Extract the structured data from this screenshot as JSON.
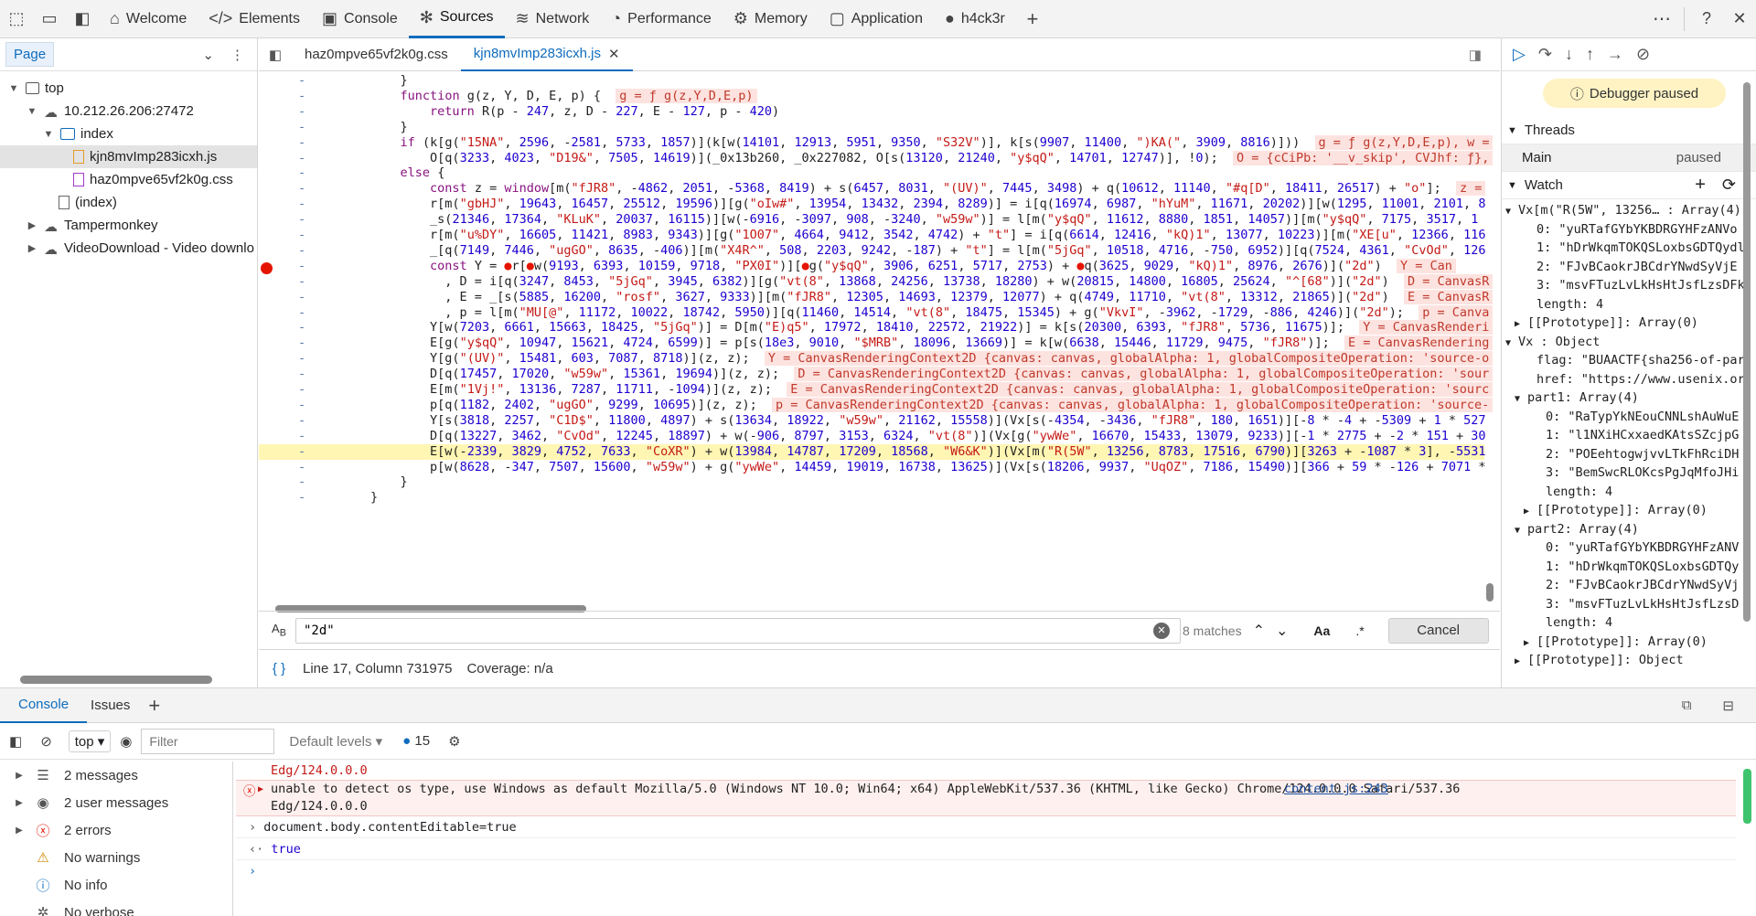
{
  "topbar": {
    "tabs": [
      {
        "label": "Welcome",
        "icon": "home-icon"
      },
      {
        "label": "Elements",
        "icon": "code-icon"
      },
      {
        "label": "Console",
        "icon": "console-icon"
      },
      {
        "label": "Sources",
        "icon": "bug-icon"
      },
      {
        "label": "Network",
        "icon": "wifi-icon"
      },
      {
        "label": "Performance",
        "icon": "gauge-icon"
      },
      {
        "label": "Memory",
        "icon": "chip-icon"
      },
      {
        "label": "Application",
        "icon": "app-icon"
      },
      {
        "label": "h4ck3r",
        "icon": "avatar-icon"
      }
    ],
    "active_tab": "Sources"
  },
  "navigator": {
    "header": "Page",
    "tree": [
      "top",
      "10.212.26.206:27472",
      "index",
      "kjn8mvImp283icxh.js",
      "haz0mpve65vf2k0g.css",
      "(index)",
      "Tampermonkey",
      "VideoDownload - Video downlo"
    ]
  },
  "editor": {
    "tabs": [
      "haz0mpve65vf2k0g.css",
      "kjn8mvImp283icxh.js"
    ],
    "active_tab": "kjn8mvImp283icxh.js"
  },
  "code_lines": [
    {
      "text": "            }",
      "hl": false,
      "bp": false
    },
    {
      "text": "            function g(z, Y, D, E, p) {  ",
      "inline": "g = ƒ g(z,Y,D,E,p)",
      "hl": false,
      "bp": false
    },
    {
      "text": "                return R(p - 247, z, D - 227, E - 127, p - 420)",
      "hl": false,
      "bp": false
    },
    {
      "text": "            }",
      "hl": false,
      "bp": false
    },
    {
      "text": "            if (k[g(\"15NA\", 2596, -2581, 5733, 1857)](k[w(14101, 12913, 5951, 9350, \"S32V\")], k[s(9907, 11400, \")KA(\", 3909, 8816)]))  ",
      "inline": "g = ƒ g(z,Y,D,E,p), w =",
      "hl": false,
      "bp": false
    },
    {
      "text": "                O[q(3233, 4023, \"D19&\", 7505, 14619)](_0x13b260, _0x227082, O[s(13120, 21240, \"y$qQ\", 14701, 12747)], !0);  ",
      "inline": "O = {cCiPb: '__v_skip', CVJhf: ƒ},",
      "hl": false,
      "bp": false
    },
    {
      "text": "            else {",
      "hl": false,
      "bp": false
    },
    {
      "text": "                const z = window[m(\"fJR8\", -4862, 2051, -5368, 8419) + s(6457, 8031, \"(UV)\", 7445, 3498) + q(10612, 11140, \"#q[D\", 18411, 26517) + \"o\"];  ",
      "inline": "z =",
      "hl": false,
      "bp": false
    },
    {
      "text": "                r[m(\"gbHJ\", 19643, 16457, 25512, 19596)][g(\"oIw#\", 13954, 13432, 2394, 8289)] = i[q(16974, 6987, \"hYuM\", 11671, 20202)][w(1295, 11001, 2101, 8",
      "hl": false,
      "bp": false
    },
    {
      "text": "                _s(21346, 17364, \"KLuK\", 20037, 16115)][w(-6916, -3097, 908, -3240, \"w59w\")] = l[m(\"y$qQ\", 11612, 8880, 1851, 14057)][m(\"y$qQ\", 7175, 3517, 1",
      "hl": false,
      "bp": false
    },
    {
      "text": "                r[m(\"u%DY\", 16605, 11421, 8983, 9343)][g(\"1O07\", 4664, 9412, 3542, 4742) + \"t\"] = i[q(6614, 12416, \"kQ)1\", 13077, 10223)][m(\"XE[u\", 12366, 116",
      "hl": false,
      "bp": false
    },
    {
      "text": "                _[q(7149, 7446, \"ugGO\", 8635, -406)][m(\"X4R^\", 508, 2203, 9242, -187) + \"t\"] = l[m(\"5jGq\", 10518, 4716, -750, 6952)][q(7524, 4361, \"CvOd\", 126",
      "hl": false,
      "bp": false
    },
    {
      "text": "                const Y = ●r[●w(9193, 6393, 10159, 9718, \"PX0I\")][●g(\"y$qQ\", 3906, 6251, 5717, 2753) + ●q(3625, 9029, \"kQ)1\", 8976, 2676)](\"2d\")  ",
      "inline": "Y = Can",
      "hl": false,
      "bp": true
    },
    {
      "text": "                  , D = i[q(3247, 8453, \"5jGq\", 3945, 6382)][g(\"vt(8\", 13868, 24256, 13738, 18280) + w(20815, 14800, 16805, 25624, \"^[68\")](\"2d\")  ",
      "inline": "D = CanvasR",
      "hl": false,
      "bp": false
    },
    {
      "text": "                  , E = _[s(5885, 16200, \"rosf\", 3627, 9333)][m(\"fJR8\", 12305, 14693, 12379, 12077) + q(4749, 11710, \"vt(8\", 13312, 21865)](\"2d\")  ",
      "inline": "E = CanvasR",
      "hl": false,
      "bp": false
    },
    {
      "text": "                  , p = l[m(\"MU[@\", 11172, 10022, 18742, 5950)][q(11460, 14514, \"vt(8\", 18475, 15345) + g(\"VkvI\", -3962, -1729, -886, 4246)](\"2d\");  ",
      "inline": "p = Canva",
      "hl": false,
      "bp": false
    },
    {
      "text": "                Y[w(7203, 6661, 15663, 18425, \"5jGq\")] = D[m(\"E)q5\", 17972, 18410, 22572, 21922)] = k[s(20300, 6393, \"fJR8\", 5736, 11675)];  ",
      "inline": "Y = CanvasRenderi",
      "hl": false,
      "bp": false
    },
    {
      "text": "                E[g(\"y$qQ\", 10947, 15621, 4724, 6599)] = p[s(18e3, 9010, \"$MRB\", 18096, 13669)] = k[w(6638, 15446, 11729, 9475, \"fJR8\")];  ",
      "inline": "E = CanvasRendering",
      "hl": false,
      "bp": false
    },
    {
      "text": "                Y[g(\"(UV)\", 15481, 603, 7087, 8718)](z, z);  ",
      "inline": "Y = CanvasRenderingContext2D {canvas: canvas, globalAlpha: 1, globalCompositeOperation: 'source-o",
      "hl": false,
      "bp": false
    },
    {
      "text": "                D[q(17457, 17020, \"w59w\", 15361, 19694)](z, z);  ",
      "inline": "D = CanvasRenderingContext2D {canvas: canvas, globalAlpha: 1, globalCompositeOperation: 'sour",
      "hl": false,
      "bp": false
    },
    {
      "text": "                E[m(\"1Vj!\", 13136, 7287, 11711, -1094)](z, z);  ",
      "inline": "E = CanvasRenderingContext2D {canvas: canvas, globalAlpha: 1, globalCompositeOperation: 'sourc",
      "hl": false,
      "bp": false
    },
    {
      "text": "                p[q(1182, 2402, \"ugGO\", 9299, 10695)](z, z);  ",
      "inline": "p = CanvasRenderingContext2D {canvas: canvas, globalAlpha: 1, globalCompositeOperation: 'source-",
      "hl": false,
      "bp": false
    },
    {
      "text": "                Y[s(3818, 2257, \"C1D$\", 11800, 4897) + s(13634, 18922, \"w59w\", 21162, 15558)](Vx[s(-4354, -3436, \"fJR8\", 180, 1651)][-8 * -4 + -5309 + 1 * 527",
      "hl": false,
      "bp": false
    },
    {
      "text": "                D[q(13227, 3462, \"CvOd\", 12245, 18897) + w(-906, 8797, 3153, 6324, \"vt(8\")](Vx[g(\"ywWe\", 16670, 15433, 13079, 9233)][-1 * 2775 + -2 * 151 + 30",
      "hl": false,
      "bp": false
    },
    {
      "text": "                E[w(-2339, 3829, 4752, 7633, \"CoXR\") + w(13984, 14787, 17209, 18568, \"W6&K\")](Vx[m(\"R(5W\", 13256, 8783, 17516, 6790)][3263 + -1087 * 3], -5531",
      "hl": true,
      "bp": false
    },
    {
      "text": "                p[w(8628, -347, 7507, 15600, \"w59w\") + g(\"ywWe\", 14459, 19019, 16738, 13625)](Vx[s(18206, 9937, \"UqOZ\", 7186, 15490)][366 + 59 * -126 + 7071 *",
      "hl": false,
      "bp": false
    },
    {
      "text": "            }",
      "hl": false,
      "bp": false
    },
    {
      "text": "        }",
      "hl": false,
      "bp": false
    }
  ],
  "search": {
    "value": "\"2d\"",
    "matches": "8 matches",
    "cancel": "Cancel",
    "aa": "Aa",
    "regex": ".*"
  },
  "status": {
    "position": "Line 17, Column 731975",
    "coverage": "Coverage: n/a"
  },
  "debugger": {
    "paused": "Debugger paused",
    "threads": "Threads",
    "thread_main": "Main",
    "thread_state": "paused",
    "watch": "Watch",
    "watch_rows": [
      {
        "indent": 0,
        "tri": "▼",
        "text": "Vx[m(\"R(5W\", 13256… : Array(4)"
      },
      {
        "indent": 2,
        "tri": "",
        "text": "0: \"yuRTafGYbYKBDRGYHFzANVo"
      },
      {
        "indent": 2,
        "tri": "",
        "text": "1: \"hDrWkqmTOKQSLoxbsGDTQydl"
      },
      {
        "indent": 2,
        "tri": "",
        "text": "2: \"FJvBCaokrJBCdrYNwdSyVjE"
      },
      {
        "indent": 2,
        "tri": "",
        "text": "3: \"msvFTuzLvLkHsHtJsfLzsDFk"
      },
      {
        "indent": 2,
        "tri": "",
        "text": "length: 4"
      },
      {
        "indent": 1,
        "tri": "▶",
        "text": "[[Prototype]]: Array(0)"
      },
      {
        "indent": 0,
        "tri": "▼",
        "text": "Vx : Object"
      },
      {
        "indent": 2,
        "tri": "",
        "text": "flag: \"BUAACTF{sha256-of-par"
      },
      {
        "indent": 2,
        "tri": "",
        "text": "href: \"https://www.usenix.or"
      },
      {
        "indent": 1,
        "tri": "▼",
        "text": "part1: Array(4)"
      },
      {
        "indent": 3,
        "tri": "",
        "text": "0: \"RaTypYkNEouCNNLshAuWuE"
      },
      {
        "indent": 3,
        "tri": "",
        "text": "1: \"l1NXiHCxxaedKAtsSZcjpG"
      },
      {
        "indent": 3,
        "tri": "",
        "text": "2: \"POEehtogwjvvLTkFhRciDH"
      },
      {
        "indent": 3,
        "tri": "",
        "text": "3: \"BemSwcRLOKcsPgJqMfoJHi"
      },
      {
        "indent": 3,
        "tri": "",
        "text": "length: 4"
      },
      {
        "indent": 2,
        "tri": "▶",
        "text": "[[Prototype]]: Array(0)"
      },
      {
        "indent": 1,
        "tri": "▼",
        "text": "part2: Array(4)"
      },
      {
        "indent": 3,
        "tri": "",
        "text": "0: \"yuRTafGYbYKBDRGYHFzANV"
      },
      {
        "indent": 3,
        "tri": "",
        "text": "1: \"hDrWkqmTOKQSLoxbsGDTQy"
      },
      {
        "indent": 3,
        "tri": "",
        "text": "2: \"FJvBCaokrJBCdrYNwdSyVj"
      },
      {
        "indent": 3,
        "tri": "",
        "text": "3: \"msvFTuzLvLkHsHtJsfLzsD"
      },
      {
        "indent": 3,
        "tri": "",
        "text": "length: 4"
      },
      {
        "indent": 2,
        "tri": "▶",
        "text": "[[Prototype]]: Array(0)"
      },
      {
        "indent": 1,
        "tri": "▶",
        "text": "[[Prototype]]: Object"
      }
    ]
  },
  "drawer": {
    "tabs": [
      "Console",
      "Issues"
    ],
    "context": "top",
    "filter_placeholder": "Filter",
    "levels": "Default levels",
    "issues_count": "15",
    "sidebar": [
      {
        "label": "2 messages",
        "icon": "list-icon"
      },
      {
        "label": "2 user messages",
        "icon": "user-icon"
      },
      {
        "label": "2 errors",
        "icon": "error-icon"
      },
      {
        "label": "No warnings",
        "icon": "warning-icon"
      },
      {
        "label": "No info",
        "icon": "info-icon"
      },
      {
        "label": "No verbose",
        "icon": "verbose-icon"
      }
    ],
    "log_prev_tail": "Edg/124.0.0.0",
    "error_text": "unable to detect os type, use Windows as default  Mozilla/5.0 (Windows NT 10.0; Win64; x64) AppleWebKit/537.36 (KHTML, like Gecko) Chrome/124.0.0.0 Safari/537.36",
    "error_text2": "Edg/124.0.0.0",
    "error_source": "content.js:243",
    "input_cmd": "document.body.contentEditable=true",
    "result": "true"
  }
}
